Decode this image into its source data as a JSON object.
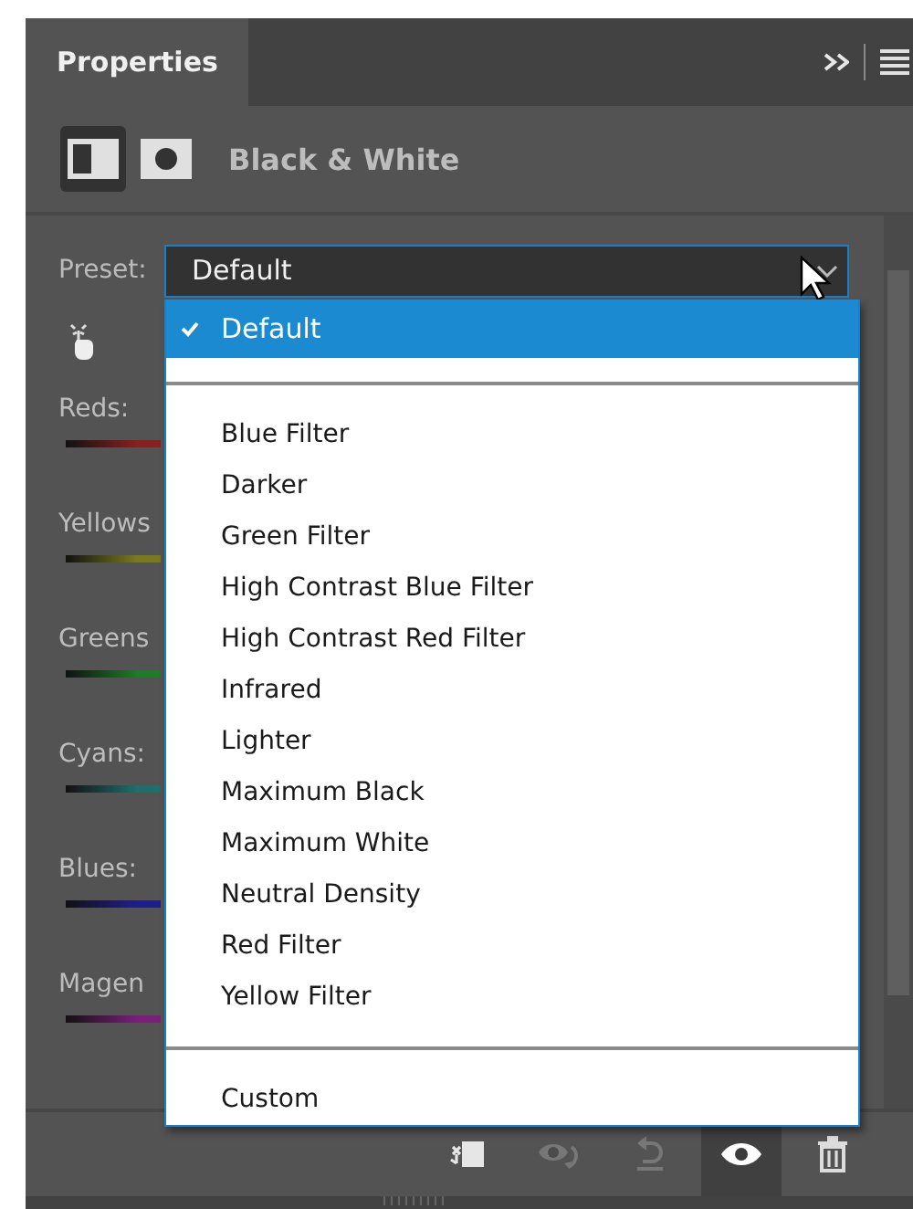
{
  "panel_tab": {
    "label": "Properties",
    "selected": true
  },
  "header": {
    "modes": [
      {
        "kind": "adjustment",
        "selected": true
      },
      {
        "kind": "mask",
        "selected": false
      }
    ],
    "title": "Black & White"
  },
  "preset": {
    "label": "Preset:",
    "value": "Default"
  },
  "preset_menu": {
    "groups": [
      [
        {
          "label": "Default",
          "selected": true
        }
      ],
      [
        {
          "label": "Blue Filter",
          "selected": false
        },
        {
          "label": "Darker",
          "selected": false
        },
        {
          "label": "Green Filter",
          "selected": false
        },
        {
          "label": "High Contrast Blue Filter",
          "selected": false
        },
        {
          "label": "High Contrast Red Filter",
          "selected": false
        },
        {
          "label": "Infrared",
          "selected": false
        },
        {
          "label": "Lighter",
          "selected": false
        },
        {
          "label": "Maximum Black",
          "selected": false
        },
        {
          "label": "Maximum White",
          "selected": false
        },
        {
          "label": "Neutral Density",
          "selected": false
        },
        {
          "label": "Red Filter",
          "selected": false
        },
        {
          "label": "Yellow Filter",
          "selected": false
        }
      ],
      [
        {
          "label": "Custom",
          "selected": false
        }
      ]
    ]
  },
  "sliders": [
    {
      "label": "Reds:",
      "color": "#8a1f1f"
    },
    {
      "label": "Yellows",
      "color": "#7a7a1c"
    },
    {
      "label": "Greens",
      "color": "#1f7a2a"
    },
    {
      "label": "Cyans:",
      "color": "#1f6f6a"
    },
    {
      "label": "Blues:",
      "color": "#1f1f8a"
    },
    {
      "label": "Magen",
      "color": "#7a1f7a"
    }
  ],
  "toolbar": [
    {
      "kind": "clip",
      "disabled": false,
      "pressed": false
    },
    {
      "kind": "previous",
      "disabled": true,
      "pressed": false
    },
    {
      "kind": "reset",
      "disabled": true,
      "pressed": false
    },
    {
      "kind": "visibility",
      "disabled": false,
      "pressed": true
    },
    {
      "kind": "delete",
      "disabled": false,
      "pressed": false
    }
  ]
}
